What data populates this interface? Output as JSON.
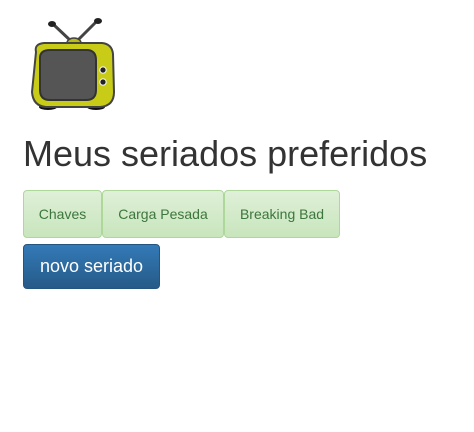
{
  "page": {
    "title": "Meus seriados preferidos"
  },
  "logo": {
    "icon": "tv-icon"
  },
  "series": [
    {
      "label": "Chaves"
    },
    {
      "label": "Carga Pesada"
    },
    {
      "label": "Breaking Bad"
    }
  ],
  "actions": {
    "new_label": "novo seriado"
  },
  "colors": {
    "series_button_bg": "#dff0d8",
    "series_button_text": "#3c763d",
    "primary_button_bg": "#337ab7",
    "tv_body": "#c8cc16",
    "tv_screen": "#555555"
  }
}
